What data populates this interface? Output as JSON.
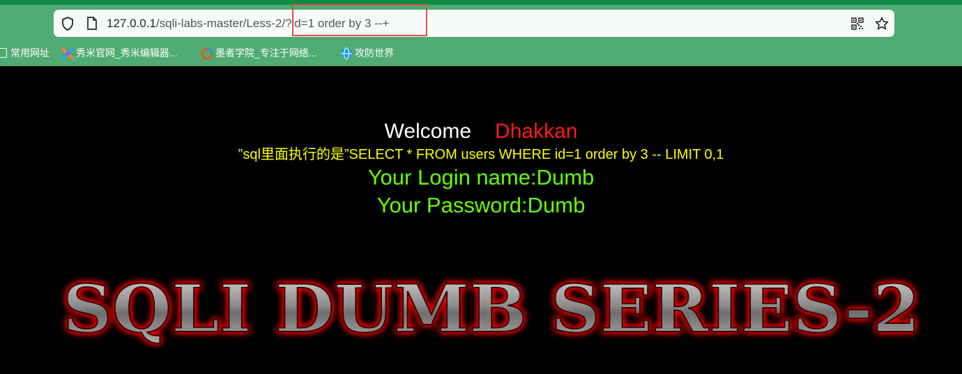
{
  "browser": {
    "url_host": "127.0.0.1",
    "url_path": "/sqli-labs-master/Less-2/?id=1 order by 3 --+",
    "icons": {
      "security": "shield-icon",
      "page": "document-icon",
      "qr": "qr-code-icon",
      "favorite": "star-icon"
    },
    "bookmarks": [
      {
        "label": "常用网址",
        "icon": "folder-icon"
      },
      {
        "label": "秀米官网_秀米编辑器...",
        "icon": "xiumi-icon"
      },
      {
        "label": "墨者学院_专注于网络...",
        "icon": "mozhe-icon"
      },
      {
        "label": "攻防世界",
        "icon": "globe-icon"
      }
    ]
  },
  "page": {
    "welcome": "Welcome",
    "name": "Dhakkan",
    "sql_text": "”sql里面执行的是”SELECT * FROM users WHERE id=1 order by 3 -- LIMIT 0,1",
    "login_name": "Your Login name:Dumb",
    "password": "Your Password:Dumb",
    "banner_title": "SQLI DUMB SERIES-2"
  },
  "colors": {
    "chrome_green": "#50ab73",
    "welcome_white": "#ffffff",
    "name_red": "#ff1a1a",
    "sql_yellow": "#ffff00",
    "result_green": "#66ff00",
    "banner_glow": "#ff0000"
  }
}
